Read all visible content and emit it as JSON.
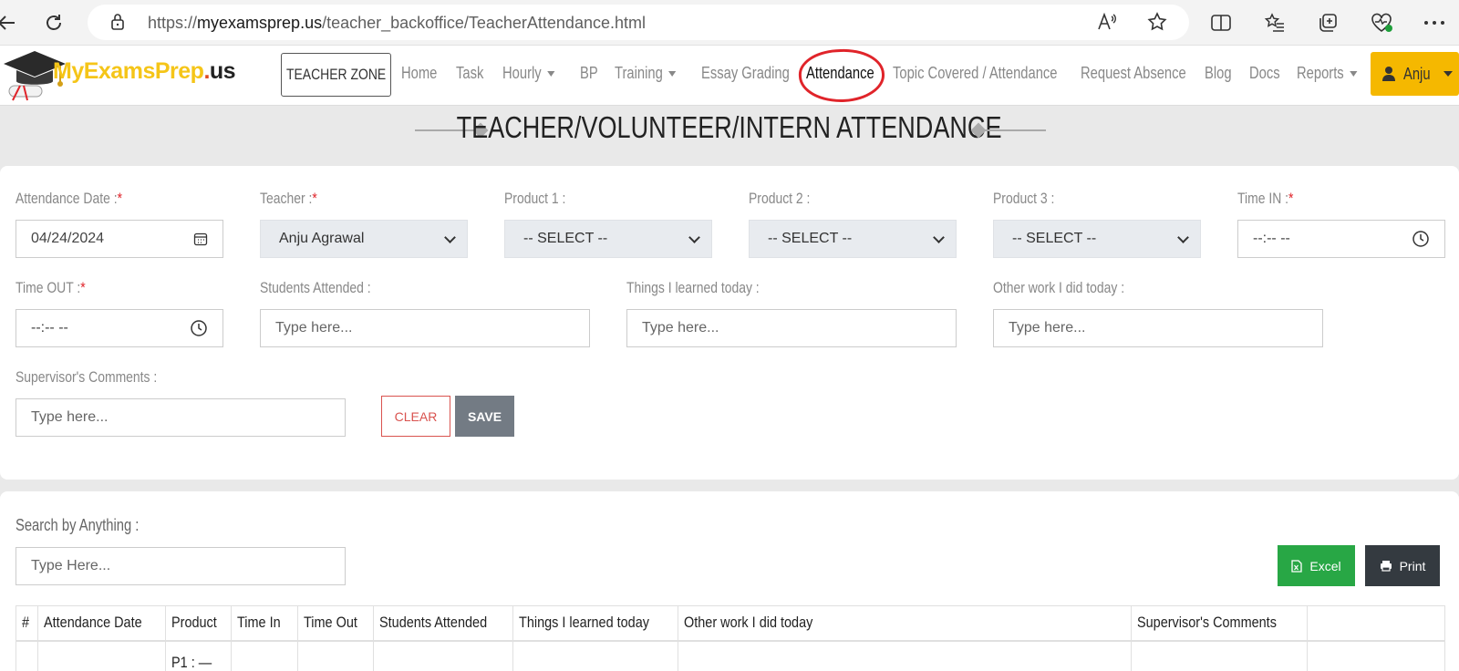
{
  "browser": {
    "url_prefix": "https://",
    "url_domain": "myexamsprep.us",
    "url_path": "/teacher_backoffice/TeacherAttendance.html"
  },
  "logo": {
    "part1": "MyExamsPrep",
    "part2": ".",
    "part3": "us"
  },
  "nav": {
    "teacher_zone": "TEACHER ZONE",
    "home": "Home",
    "task": "Task",
    "hourly": "Hourly",
    "bp": "BP",
    "training": "Training",
    "essay_grading": "Essay Grading",
    "attendance": "Attendance",
    "topic_covered": "Topic Covered / Attendance",
    "request_absence": "Request Absence",
    "blog": "Blog",
    "docs": "Docs",
    "reports": "Reports",
    "user": "Anju"
  },
  "page_title": "TEACHER/VOLUNTEER/INTERN ATTENDANCE",
  "form": {
    "attendance_date_label": "Attendance Date :",
    "attendance_date_value": "04/24/2024",
    "teacher_label": "Teacher :",
    "teacher_value": "Anju Agrawal",
    "product1_label": "Product 1 :",
    "product1_value": "-- SELECT --",
    "product2_label": "Product 2 :",
    "product2_value": "-- SELECT --",
    "product3_label": "Product 3 :",
    "product3_value": "-- SELECT --",
    "time_in_label": "Time IN :",
    "time_in_value": "--:-- --",
    "time_out_label": "Time OUT :",
    "time_out_value": "--:-- --",
    "students_label": "Students Attended :",
    "students_placeholder": "Type here...",
    "learned_label": "Things I learned today :",
    "learned_placeholder": "Type here...",
    "other_work_label": "Other work I did today :",
    "other_work_placeholder": "Type here...",
    "supervisor_label": "Supervisor's Comments :",
    "supervisor_placeholder": "Type here...",
    "required_mark": "*",
    "clear_button": "CLEAR",
    "save_button": "SAVE"
  },
  "list": {
    "search_label": "Search by Anything :",
    "search_placeholder": "Type Here...",
    "excel_button": "Excel",
    "print_button": "Print",
    "columns": [
      "#",
      "Attendance Date",
      "Product",
      "Time In",
      "Time Out",
      "Students Attended",
      "Things I learned today",
      "Other work I did today",
      "Supervisor's Comments",
      ""
    ],
    "rows": [
      [
        "",
        "",
        "P1 : —",
        "",
        "",
        "",
        "",
        "",
        "",
        ""
      ]
    ]
  },
  "colors": {
    "accent_yellow": "#f5b800",
    "excel_green": "#28a745",
    "print_dark": "#343a40",
    "clear_red": "#d9534f",
    "highlight_red": "#e0242a"
  }
}
